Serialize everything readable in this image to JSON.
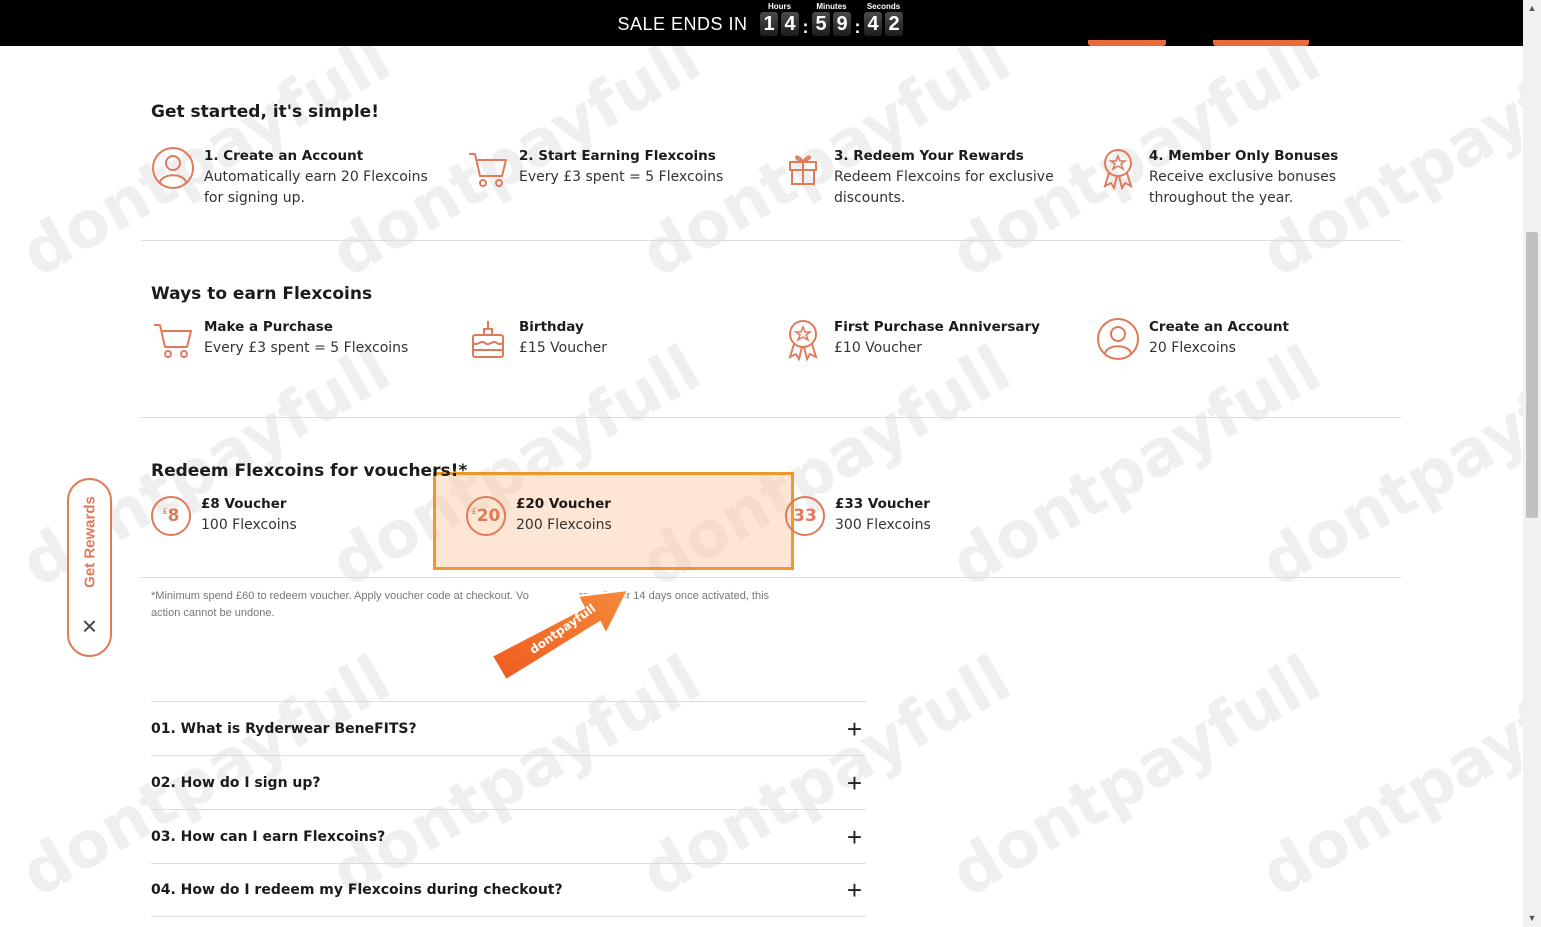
{
  "sale_bar": {
    "label": "SALE ENDS IN",
    "hours_label": "Hours",
    "minutes_label": "Minutes",
    "seconds_label": "Seconds",
    "hours_digits": [
      "1",
      "4"
    ],
    "minutes_digits": [
      "5",
      "9"
    ],
    "seconds_digits": [
      "4",
      "2"
    ],
    "colon": ":"
  },
  "get_started": {
    "title": "Get started, it's simple!",
    "steps": [
      {
        "title": "1. Create an Account",
        "line1": "Automatically earn 20 Flexcoins",
        "line2": "for signing up.",
        "icon": "user-circle-icon"
      },
      {
        "title": "2. Start Earning Flexcoins",
        "line1": "Every £3 spent = 5 Flexcoins",
        "line2": "",
        "icon": "cart-icon"
      },
      {
        "title": "3. Redeem Your Rewards",
        "line1": "Redeem Flexcoins for exclusive",
        "line2": "discounts.",
        "icon": "gift-icon"
      },
      {
        "title": "4. Member Only Bonuses",
        "line1": "Receive exclusive bonuses",
        "line2": "throughout the year.",
        "icon": "award-badge-icon"
      }
    ]
  },
  "ways_to_earn": {
    "title": "Ways to earn Flexcoins",
    "items": [
      {
        "title": "Make a Purchase",
        "line1": "Every £3 spent = 5 Flexcoins",
        "icon": "cart-icon"
      },
      {
        "title": "Birthday",
        "line1": "£15 Voucher",
        "icon": "cake-icon"
      },
      {
        "title": "First Purchase Anniversary",
        "line1": "£10 Voucher",
        "icon": "award-badge-icon"
      },
      {
        "title": "Create an Account",
        "line1": "20 Flexcoins",
        "icon": "user-circle-icon"
      }
    ]
  },
  "redeem": {
    "title": "Redeem Flexcoins for vouchers!*",
    "vouchers": [
      {
        "title": "£8 Voucher",
        "line1": "100 Flexcoins",
        "badge_currency": "£",
        "badge_value": "8"
      },
      {
        "title": "£20 Voucher",
        "line1": "200 Flexcoins",
        "badge_currency": "£",
        "badge_value": "20"
      },
      {
        "title": "£33 Voucher",
        "line1": "300 Flexcoins",
        "badge_currency": "",
        "badge_value": "33"
      }
    ],
    "footnote_line1": "*Minimum spend £60 to redeem voucher. Apply voucher code at checkout. Vo",
    "footnote_line1b": "re valid for 14 days once activated, this",
    "footnote_line2": "action cannot be undone."
  },
  "rewards_pill": {
    "label": "Get Rewards",
    "close": "✕"
  },
  "faq": [
    {
      "question": "01. What is Ryderwear BeneFITS?"
    },
    {
      "question": "02. How do I sign up?"
    },
    {
      "question": "03. How can I earn Flexcoins?"
    },
    {
      "question": "04. How do I redeem my Flexcoins during checkout?"
    }
  ],
  "faq_toggle": "+",
  "watermark": "dontpayfull",
  "arrow_label": "dontpayfull",
  "colors": {
    "accent": "#e07a5a",
    "highlight_border": "#f0962e",
    "arrow": "#f05a1e"
  }
}
